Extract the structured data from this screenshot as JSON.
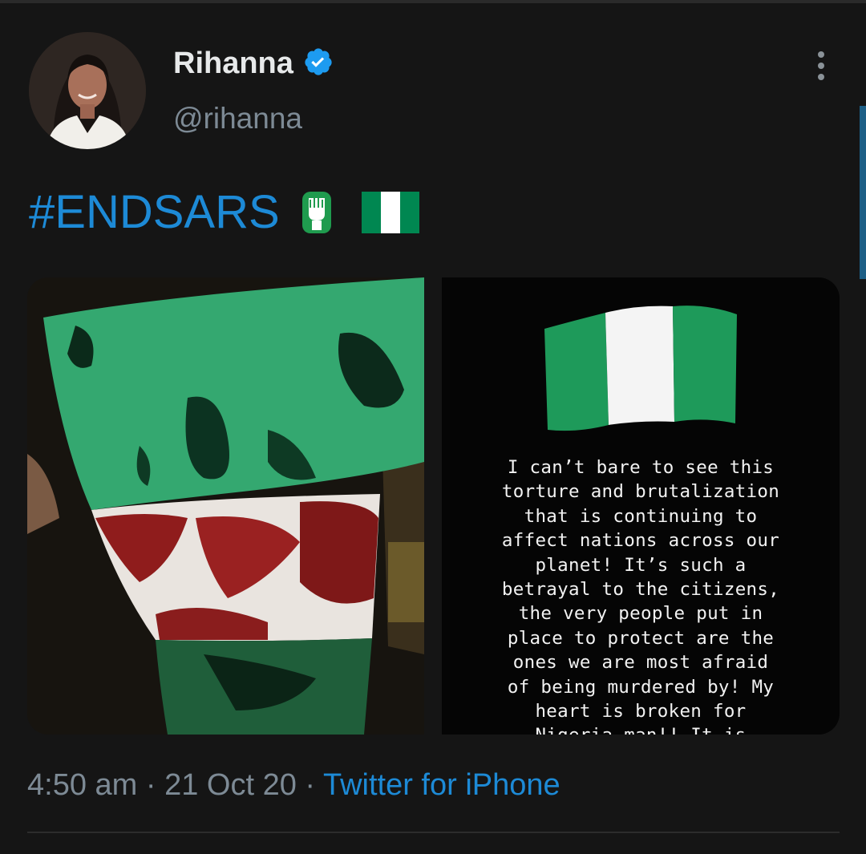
{
  "tweet": {
    "author": {
      "name": "Rihanna",
      "handle": "@rihanna",
      "verified": true,
      "avatar_icon": "profile-photo"
    },
    "text": {
      "hashtag": "#ENDSARS",
      "emojis": [
        "raised-fist-icon",
        "nigeria-flag-icon"
      ]
    },
    "media": {
      "left_image": "blood-stained-nigerian-flag-photo",
      "right_image": {
        "flag": "nigeria-flag-icon",
        "lines": [
          "I can’t bare to see this",
          "torture and brutalization",
          "that is continuing to",
          "affect nations across our",
          "planet! It’s such a",
          "betrayal to the citizens,",
          "the very people put in",
          "place to protect are the",
          "ones we are most afraid",
          "of being murdered by! My",
          "heart is broken for",
          "Nigeria man!! It is"
        ]
      }
    },
    "meta": {
      "time": "4:50 am",
      "separator": " · ",
      "date": "21 Oct 20",
      "source": "Twitter for iPhone"
    }
  },
  "colors": {
    "background": "#151515",
    "link": "#1d8ad6",
    "verified": "#1d9bf0",
    "nigeria_green": "#008751"
  },
  "icons": {
    "more": "more-vertical-icon",
    "verified": "verified-badge-icon"
  }
}
